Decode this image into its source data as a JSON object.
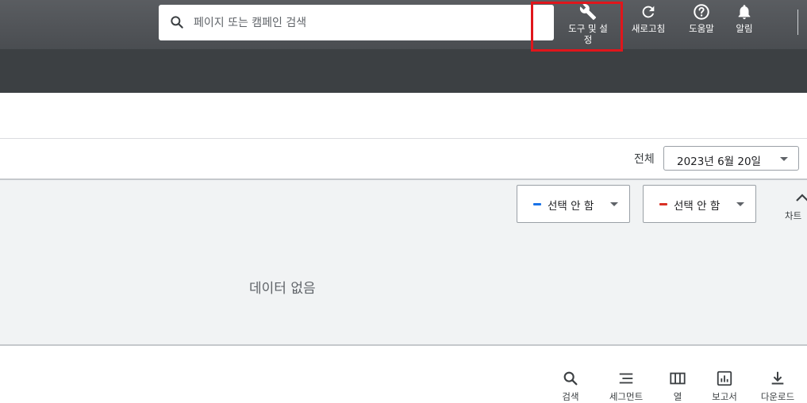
{
  "search": {
    "placeholder": "페이지 또는 캠페인 검색",
    "value": ""
  },
  "header_tools": [
    {
      "id": "tools-settings",
      "icon": "wrench-icon",
      "label_line1": "도구 및 설",
      "label_line2": "정"
    },
    {
      "id": "refresh",
      "icon": "refresh-icon",
      "label": "새로고침"
    },
    {
      "id": "help",
      "icon": "help-icon",
      "label": "도움말"
    },
    {
      "id": "notifications",
      "icon": "bell-icon",
      "label": "알림"
    }
  ],
  "date_range": {
    "label": "전체",
    "value": "2023년 6월 20일"
  },
  "metrics": [
    {
      "label": "선택 안 함",
      "color": "#1a73e8"
    },
    {
      "label": "선택 안 함",
      "color": "#d93025"
    }
  ],
  "chart": {
    "collapse_label": "차트",
    "empty_message": "데이터 없음"
  },
  "bottom_tools": [
    {
      "icon": "search-icon",
      "label": "검색"
    },
    {
      "icon": "segment-icon",
      "label": "세그먼트"
    },
    {
      "icon": "columns-icon",
      "label": "열"
    },
    {
      "icon": "report-icon",
      "label": "보고서"
    },
    {
      "icon": "download-icon",
      "label": "다운로드"
    }
  ],
  "colors": {
    "accent_highlight": "#e0161b",
    "header_bg": "#4f5256",
    "band_bg": "#3c4043",
    "chart_bg": "#f1f3f4"
  }
}
